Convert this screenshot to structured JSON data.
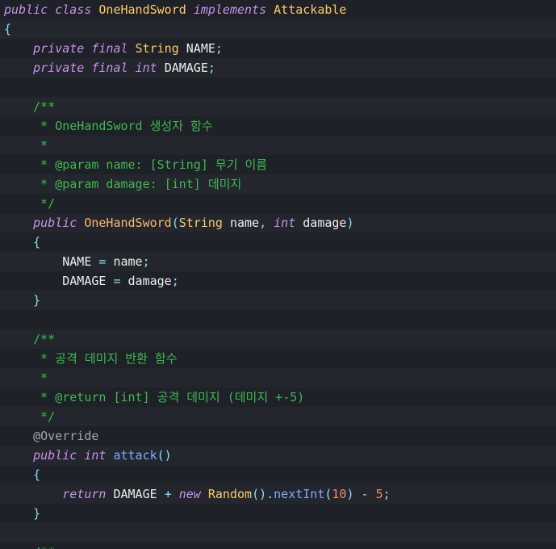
{
  "editor": {
    "lines": [
      [
        {
          "t": "public",
          "c": "kw"
        },
        {
          "t": " "
        },
        {
          "t": "class",
          "c": "kw"
        },
        {
          "t": " "
        },
        {
          "t": "OneHandSword",
          "c": "cls"
        },
        {
          "t": " "
        },
        {
          "t": "implements",
          "c": "kw"
        },
        {
          "t": " "
        },
        {
          "t": "Attackable",
          "c": "cls"
        }
      ],
      [
        {
          "t": "{",
          "c": "punc"
        }
      ],
      [
        {
          "t": "    "
        },
        {
          "t": "private",
          "c": "kw"
        },
        {
          "t": " "
        },
        {
          "t": "final",
          "c": "kw"
        },
        {
          "t": " "
        },
        {
          "t": "String",
          "c": "cls"
        },
        {
          "t": " "
        },
        {
          "t": "NAME",
          "c": "var"
        },
        {
          "t": ";",
          "c": "punc"
        }
      ],
      [
        {
          "t": "    "
        },
        {
          "t": "private",
          "c": "kw"
        },
        {
          "t": " "
        },
        {
          "t": "final",
          "c": "kw"
        },
        {
          "t": " "
        },
        {
          "t": "int",
          "c": "kw"
        },
        {
          "t": " "
        },
        {
          "t": "DAMAGE",
          "c": "var"
        },
        {
          "t": ";",
          "c": "punc"
        }
      ],
      [],
      [
        {
          "t": "    /**",
          "c": "cmt"
        }
      ],
      [
        {
          "t": "     * OneHandSword 생성자 함수",
          "c": "cmt"
        }
      ],
      [
        {
          "t": "     *",
          "c": "cmt"
        }
      ],
      [
        {
          "t": "     * @param name: [String] 무기 이름",
          "c": "cmt"
        }
      ],
      [
        {
          "t": "     * @param damage: [int] 데미지",
          "c": "cmt"
        }
      ],
      [
        {
          "t": "     */",
          "c": "cmt"
        }
      ],
      [
        {
          "t": "    "
        },
        {
          "t": "public",
          "c": "kw"
        },
        {
          "t": " "
        },
        {
          "t": "OneHandSword",
          "c": "fndecl"
        },
        {
          "t": "(",
          "c": "punc"
        },
        {
          "t": "String",
          "c": "cls"
        },
        {
          "t": " "
        },
        {
          "t": "name",
          "c": "var"
        },
        {
          "t": ",",
          "c": "punc"
        },
        {
          "t": " "
        },
        {
          "t": "int",
          "c": "kw"
        },
        {
          "t": " "
        },
        {
          "t": "damage",
          "c": "var"
        },
        {
          "t": ")",
          "c": "punc"
        }
      ],
      [
        {
          "t": "    "
        },
        {
          "t": "{",
          "c": "punc"
        }
      ],
      [
        {
          "t": "        "
        },
        {
          "t": "NAME",
          "c": "var"
        },
        {
          "t": " "
        },
        {
          "t": "=",
          "c": "op"
        },
        {
          "t": " "
        },
        {
          "t": "name",
          "c": "var"
        },
        {
          "t": ";",
          "c": "punc"
        }
      ],
      [
        {
          "t": "        "
        },
        {
          "t": "DAMAGE",
          "c": "var"
        },
        {
          "t": " "
        },
        {
          "t": "=",
          "c": "op"
        },
        {
          "t": " "
        },
        {
          "t": "damage",
          "c": "var"
        },
        {
          "t": ";",
          "c": "punc"
        }
      ],
      [
        {
          "t": "    "
        },
        {
          "t": "}",
          "c": "punc"
        }
      ],
      [],
      [
        {
          "t": "    /**",
          "c": "cmt"
        }
      ],
      [
        {
          "t": "     * 공격 데미지 반환 함수",
          "c": "cmt"
        }
      ],
      [
        {
          "t": "     *",
          "c": "cmt"
        }
      ],
      [
        {
          "t": "     * @return [int] 공격 데미지 (데미지 +-5)",
          "c": "cmt"
        }
      ],
      [
        {
          "t": "     */",
          "c": "cmt"
        }
      ],
      [
        {
          "t": "    "
        },
        {
          "t": "@Override",
          "c": "ann"
        }
      ],
      [
        {
          "t": "    "
        },
        {
          "t": "public",
          "c": "kw"
        },
        {
          "t": " "
        },
        {
          "t": "int",
          "c": "kw"
        },
        {
          "t": " "
        },
        {
          "t": "attack",
          "c": "fn"
        },
        {
          "t": "()",
          "c": "punc"
        }
      ],
      [
        {
          "t": "    "
        },
        {
          "t": "{",
          "c": "punc"
        }
      ],
      [
        {
          "t": "        "
        },
        {
          "t": "return",
          "c": "kw"
        },
        {
          "t": " "
        },
        {
          "t": "DAMAGE",
          "c": "var"
        },
        {
          "t": " "
        },
        {
          "t": "+",
          "c": "op"
        },
        {
          "t": " "
        },
        {
          "t": "new",
          "c": "kw"
        },
        {
          "t": " "
        },
        {
          "t": "Random",
          "c": "cls"
        },
        {
          "t": "().",
          "c": "punc"
        },
        {
          "t": "nextInt",
          "c": "fn"
        },
        {
          "t": "(",
          "c": "punc"
        },
        {
          "t": "10",
          "c": "num"
        },
        {
          "t": ")",
          "c": "punc"
        },
        {
          "t": " "
        },
        {
          "t": "-",
          "c": "op"
        },
        {
          "t": " "
        },
        {
          "t": "5",
          "c": "num"
        },
        {
          "t": ";",
          "c": "punc"
        }
      ],
      [
        {
          "t": "    "
        },
        {
          "t": "}",
          "c": "punc"
        }
      ],
      [],
      [
        {
          "t": "    /**",
          "c": "partial"
        }
      ]
    ]
  }
}
